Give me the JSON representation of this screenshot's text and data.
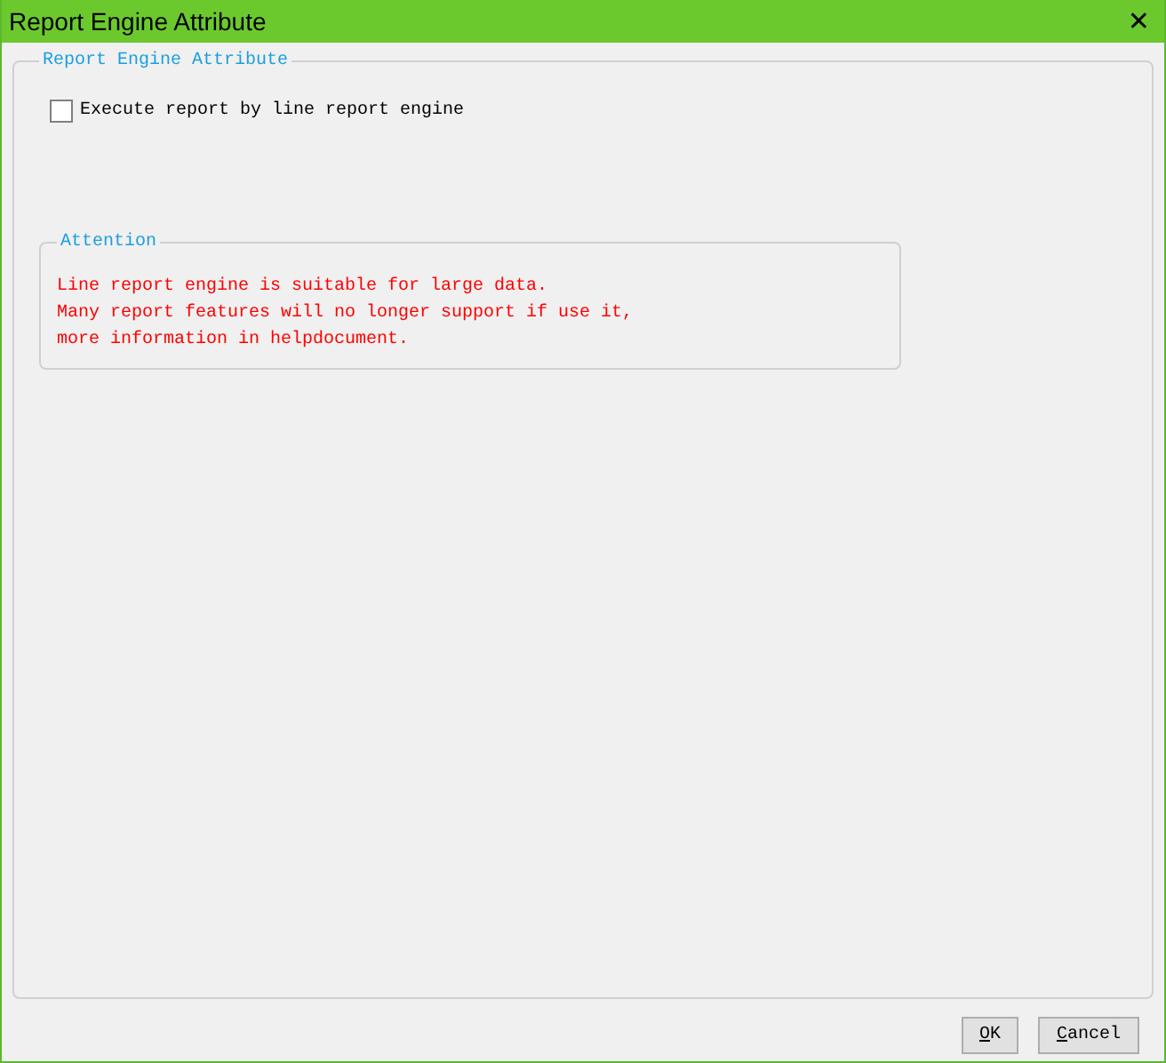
{
  "window": {
    "title": "Report Engine Attribute",
    "close": "✕"
  },
  "group": {
    "title": "Report Engine Attribute",
    "checkbox": {
      "label": "Execute report by line report engine",
      "checked": false
    },
    "attention": {
      "title": "Attention",
      "lines": [
        "Line report engine is suitable for large data.",
        "Many report features will no longer support if use it,",
        "more information in helpdocument."
      ]
    }
  },
  "buttons": [
    {
      "accel": "O",
      "rest": "K"
    },
    {
      "accel": "C",
      "rest": "ancel"
    }
  ]
}
